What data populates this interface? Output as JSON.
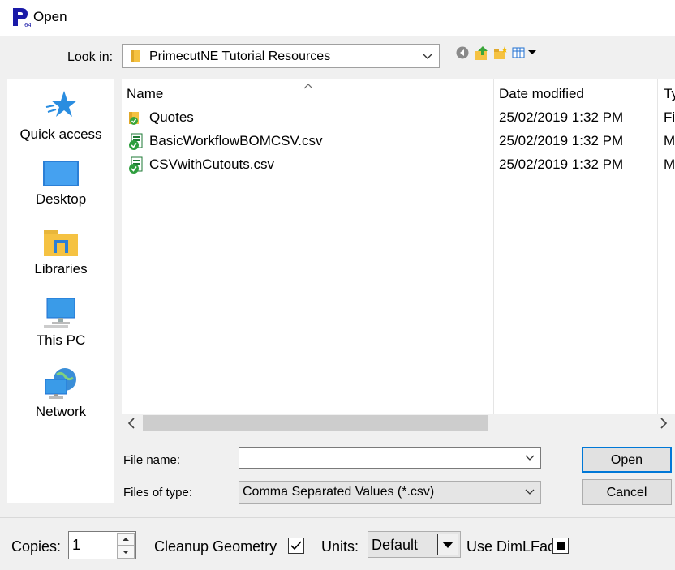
{
  "window": {
    "title": "Open",
    "app_icon_badge": "64"
  },
  "lookin": {
    "label": "Look in:",
    "value": "PrimecutNE Tutorial Resources"
  },
  "toolbar": {
    "icons": [
      "back-icon",
      "up-folder-icon",
      "new-folder-icon",
      "view-menu-icon"
    ]
  },
  "places": [
    {
      "label": "Quick access",
      "icon": "star-icon"
    },
    {
      "label": "Desktop",
      "icon": "desktop-icon"
    },
    {
      "label": "Libraries",
      "icon": "libraries-icon"
    },
    {
      "label": "This PC",
      "icon": "computer-icon"
    },
    {
      "label": "Network",
      "icon": "network-icon"
    }
  ],
  "columns": {
    "name": "Name",
    "date": "Date modified",
    "type": "Ty"
  },
  "files": [
    {
      "name": "Quotes",
      "date": "25/02/2019 1:32 PM",
      "type": "Fi",
      "icon": "folder-icon"
    },
    {
      "name": "BasicWorkflowBOMCSV.csv",
      "date": "25/02/2019 1:32 PM",
      "type": "M",
      "icon": "csv-file-icon"
    },
    {
      "name": "CSVwithCutouts.csv",
      "date": "25/02/2019 1:32 PM",
      "type": "M",
      "icon": "csv-file-icon"
    }
  ],
  "form": {
    "filename_label": "File name:",
    "filename_value": "",
    "filetype_label": "Files of type:",
    "filetype_value": "Comma Separated Values (*.csv)",
    "open_label": "Open",
    "cancel_label": "Cancel"
  },
  "options": {
    "copies_label": "Copies:",
    "copies_value": "1",
    "cleanup_label": "Cleanup Geometry",
    "cleanup_checked": true,
    "units_label": "Units:",
    "units_value": "Default",
    "dimlfac_label": "Use DimLFac",
    "dimlfac_state": "indeterminate"
  },
  "colors": {
    "accent": "#0078d7",
    "app_icon": "#1a1aa8",
    "folder": "#f5c242"
  }
}
